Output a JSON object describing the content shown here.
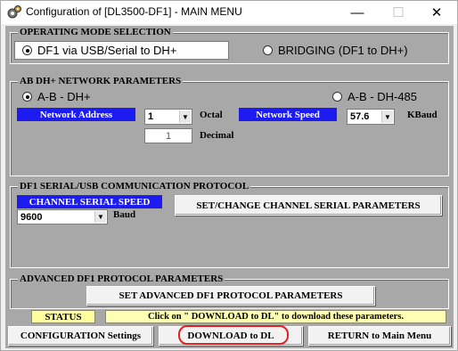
{
  "window": {
    "title": "Configuration of [DL3500-DF1] - MAIN MENU",
    "minimize_glyph": "—",
    "maximize_glyph": "☐",
    "close_glyph": "✕"
  },
  "operating_mode": {
    "group_title": "OPERATING MODE SELECTION",
    "option_df1": "DF1 via USB/Serial to DH+",
    "option_bridging": "BRIDGING (DF1 to DH+)",
    "selected": "df1"
  },
  "network": {
    "group_title": "AB DH+ NETWORK PARAMETERS",
    "option_dhplus": "A-B - DH+",
    "option_dh485": "A-B - DH-485",
    "network_address_label": "Network Address",
    "network_address_value": "1",
    "octal_label": "Octal",
    "decimal_value": "1",
    "decimal_label": "Decimal",
    "network_speed_label": "Network Speed",
    "network_speed_value": "57.6",
    "kbaud_label": "KBaud"
  },
  "df1_protocol": {
    "group_title": "DF1 SERIAL/USB COMMUNICATION PROTOCOL",
    "channel_speed_label": "CHANNEL SERIAL SPEED",
    "channel_speed_value": "9600",
    "baud_label": "Baud",
    "set_channel_button": "SET/CHANGE CHANNEL SERIAL PARAMETERS"
  },
  "advanced": {
    "group_title": "ADVANCED DF1 PROTOCOL PARAMETERS",
    "set_advanced_button": "SET ADVANCED DF1 PROTOCOL PARAMETERS"
  },
  "status": {
    "label": "STATUS",
    "message": "Click on \" DOWNLOAD to DL\"  to download these parameters."
  },
  "footer": {
    "configuration_button": "CONFIGURATION Settings",
    "download_button": "DOWNLOAD to DL",
    "return_button": "RETURN to Main Menu"
  },
  "icons": {
    "app_icon": "gears-icon",
    "dropdown": "chevron-down-icon"
  },
  "colors": {
    "client_bg": "#a8a8a8",
    "label_blue": "#1c1cf0",
    "status_yellow": "#ffff9e",
    "download_ring": "#e02020"
  }
}
